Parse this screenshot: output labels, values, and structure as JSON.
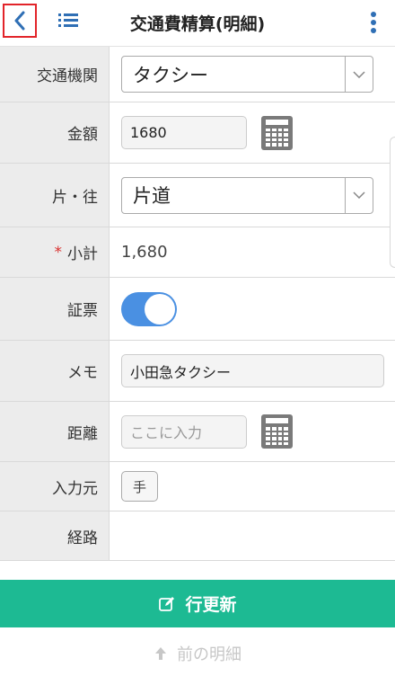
{
  "header": {
    "title": "交通費精算(明細)",
    "back_icon": "chevron-left-icon",
    "list_icon": "list-icon",
    "more_icon": "more-vertical-icon",
    "accent": "#2f6fb5"
  },
  "form": {
    "transport": {
      "label": "交通機関",
      "value": "タクシー"
    },
    "amount": {
      "label": "金額",
      "value": "1680"
    },
    "trip": {
      "label": "片・往",
      "value": "片道"
    },
    "subtotal": {
      "label": "小計",
      "required_mark": "*",
      "value": "1,680"
    },
    "receipt": {
      "label": "証票",
      "on": true
    },
    "memo": {
      "label": "メモ",
      "value": "小田急タクシー"
    },
    "distance": {
      "label": "距離",
      "placeholder": "ここに入力"
    },
    "input_source": {
      "label": "入力元",
      "value": "手"
    },
    "route": {
      "label": "経路",
      "value": ""
    }
  },
  "footer": {
    "update_label": "行更新",
    "prev_label": "前の明細",
    "update_color": "#1dba93"
  }
}
